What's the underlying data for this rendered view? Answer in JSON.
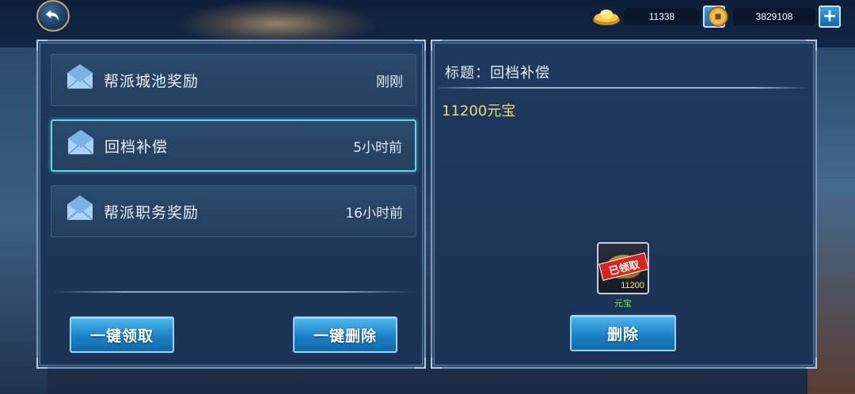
{
  "colors": {
    "accent_selected": "#5fd6e6",
    "button_blue": "#1b82c6",
    "body_gold": "#f2d77a",
    "reward_green": "#7fe04a",
    "stamp_red": "#d8231f"
  },
  "header": {
    "back_icon": "back-arrow-icon",
    "currencies": [
      {
        "icon": "gold-ingot-icon",
        "value": "11338"
      },
      {
        "icon": "copper-coin-icon",
        "value": "3829108"
      }
    ],
    "plus_label": "+"
  },
  "mail_list": {
    "items": [
      {
        "title": "帮派城池奖励",
        "time": "刚刚",
        "selected": false
      },
      {
        "title": "回档补偿",
        "time": "5小时前",
        "selected": true
      },
      {
        "title": "帮派职务奖励",
        "time": "16小时前",
        "selected": false
      }
    ],
    "claim_all_label": "一键领取",
    "delete_all_label": "一键删除"
  },
  "detail": {
    "title": "标题：回档补偿",
    "body": "11200元宝",
    "reward": {
      "stamp": "已领取",
      "quantity": "11200",
      "name": "元宝"
    },
    "delete_label": "删除"
  }
}
